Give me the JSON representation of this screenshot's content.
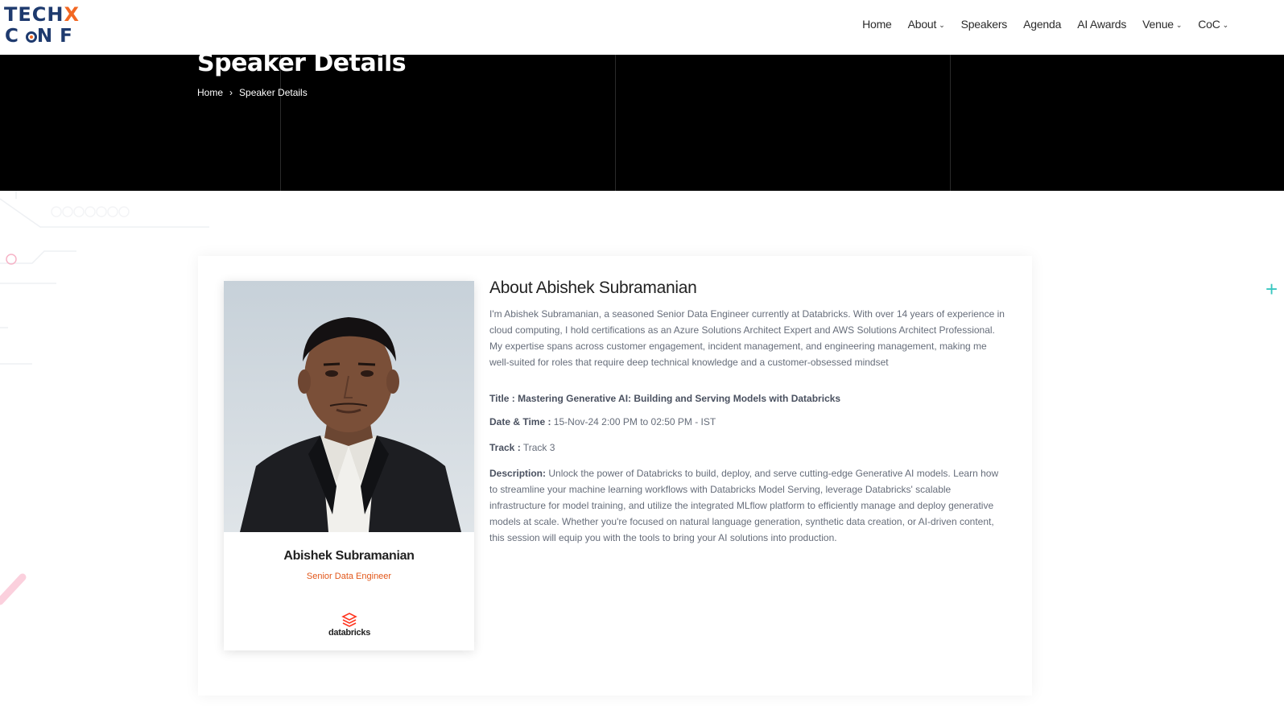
{
  "brand": {
    "logo_line1_a": "TECH",
    "logo_line1_b": "X",
    "logo_line2_a": "C",
    "logo_line2_b": "NF",
    "colors": {
      "navy": "#1e3a6e",
      "orange": "#f26722",
      "accent_teal": "#39c6c0"
    }
  },
  "nav": {
    "items": [
      {
        "label": "Home",
        "dropdown": false
      },
      {
        "label": "About",
        "dropdown": true
      },
      {
        "label": "Speakers",
        "dropdown": false
      },
      {
        "label": "Agenda",
        "dropdown": false
      },
      {
        "label": "AI Awards",
        "dropdown": false
      },
      {
        "label": "Venue",
        "dropdown": true
      },
      {
        "label": "CoC",
        "dropdown": true
      }
    ]
  },
  "hero": {
    "title": "Speaker Details",
    "breadcrumb": {
      "home": "Home",
      "current": "Speaker Details"
    }
  },
  "speaker": {
    "name": "Abishek Subramanian",
    "role": "Senior Data Engineer",
    "company": "databricks",
    "about_heading": "About Abishek Subramanian",
    "bio": "I'm Abishek Subramanian, a seasoned Senior Data Engineer currently at Databricks. With over 14 years of experience in cloud computing, I hold certifications as an Azure Solutions Architect Expert and AWS Solutions Architect Professional. My expertise spans across customer engagement, incident management, and engineering management, making me well-suited for roles that require deep technical knowledge and a customer-obsessed mindset"
  },
  "session": {
    "title_line": "Title : Mastering Generative AI: Building and Serving Models with Databricks",
    "datetime_label": "Date & Time :",
    "datetime_value": " 15-Nov-24 2:00 PM to 02:50 PM - IST",
    "track_label": "Track :",
    "track_value": " Track 3",
    "description_label": "Description:",
    "description_value": " Unlock the power of Databricks to build, deploy, and serve cutting-edge Generative AI models. Learn how to streamline your machine learning workflows with Databricks Model Serving, leverage Databricks' scalable infrastructure for model training, and utilize the integrated MLflow platform to efficiently manage and deploy generative models at scale. Whether you're focused on natural language generation, synthetic data creation, or AI-driven content, this session will equip you with the tools to bring your AI solutions into production."
  }
}
